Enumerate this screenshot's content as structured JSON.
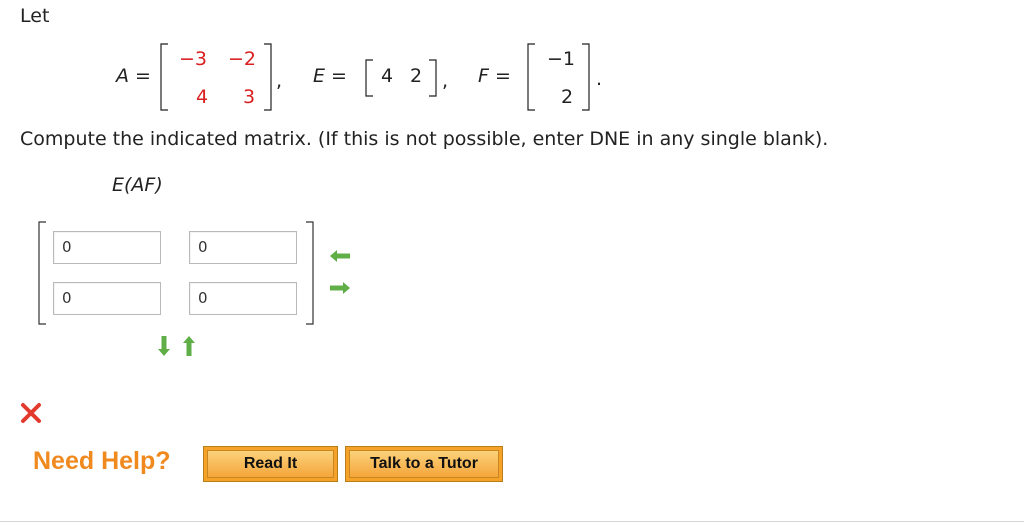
{
  "intro": "Let",
  "matrix_A": {
    "label": "A =",
    "rows": [
      [
        "−3",
        "−2"
      ],
      [
        "4",
        "3"
      ]
    ]
  },
  "matrix_E": {
    "label": "E =",
    "row": [
      "4",
      "2"
    ]
  },
  "matrix_F": {
    "label": "F =",
    "rows": [
      "−1",
      "2"
    ]
  },
  "separator": ",",
  "end_period": ".",
  "instruction": "Compute the indicated matrix. (If this is not possible, enter DNE in any single blank).",
  "expression": "E(AF)",
  "answer_grid": {
    "cells": [
      [
        "0",
        "0"
      ],
      [
        "0",
        "0"
      ]
    ]
  },
  "icons": {
    "remove_column": "arrow-left-icon",
    "add_column": "arrow-right-icon",
    "add_row": "arrow-down-icon",
    "remove_row": "arrow-up-icon",
    "status": "incorrect-x-icon"
  },
  "colors": {
    "entry_red": "#d91f1f",
    "help_orange": "#f08a1f",
    "arrow_green": "#5fae47",
    "button_orange": "#f6a229"
  },
  "help": {
    "label": "Need Help?",
    "read_it": "Read It",
    "talk_to_tutor": "Talk to a Tutor"
  }
}
